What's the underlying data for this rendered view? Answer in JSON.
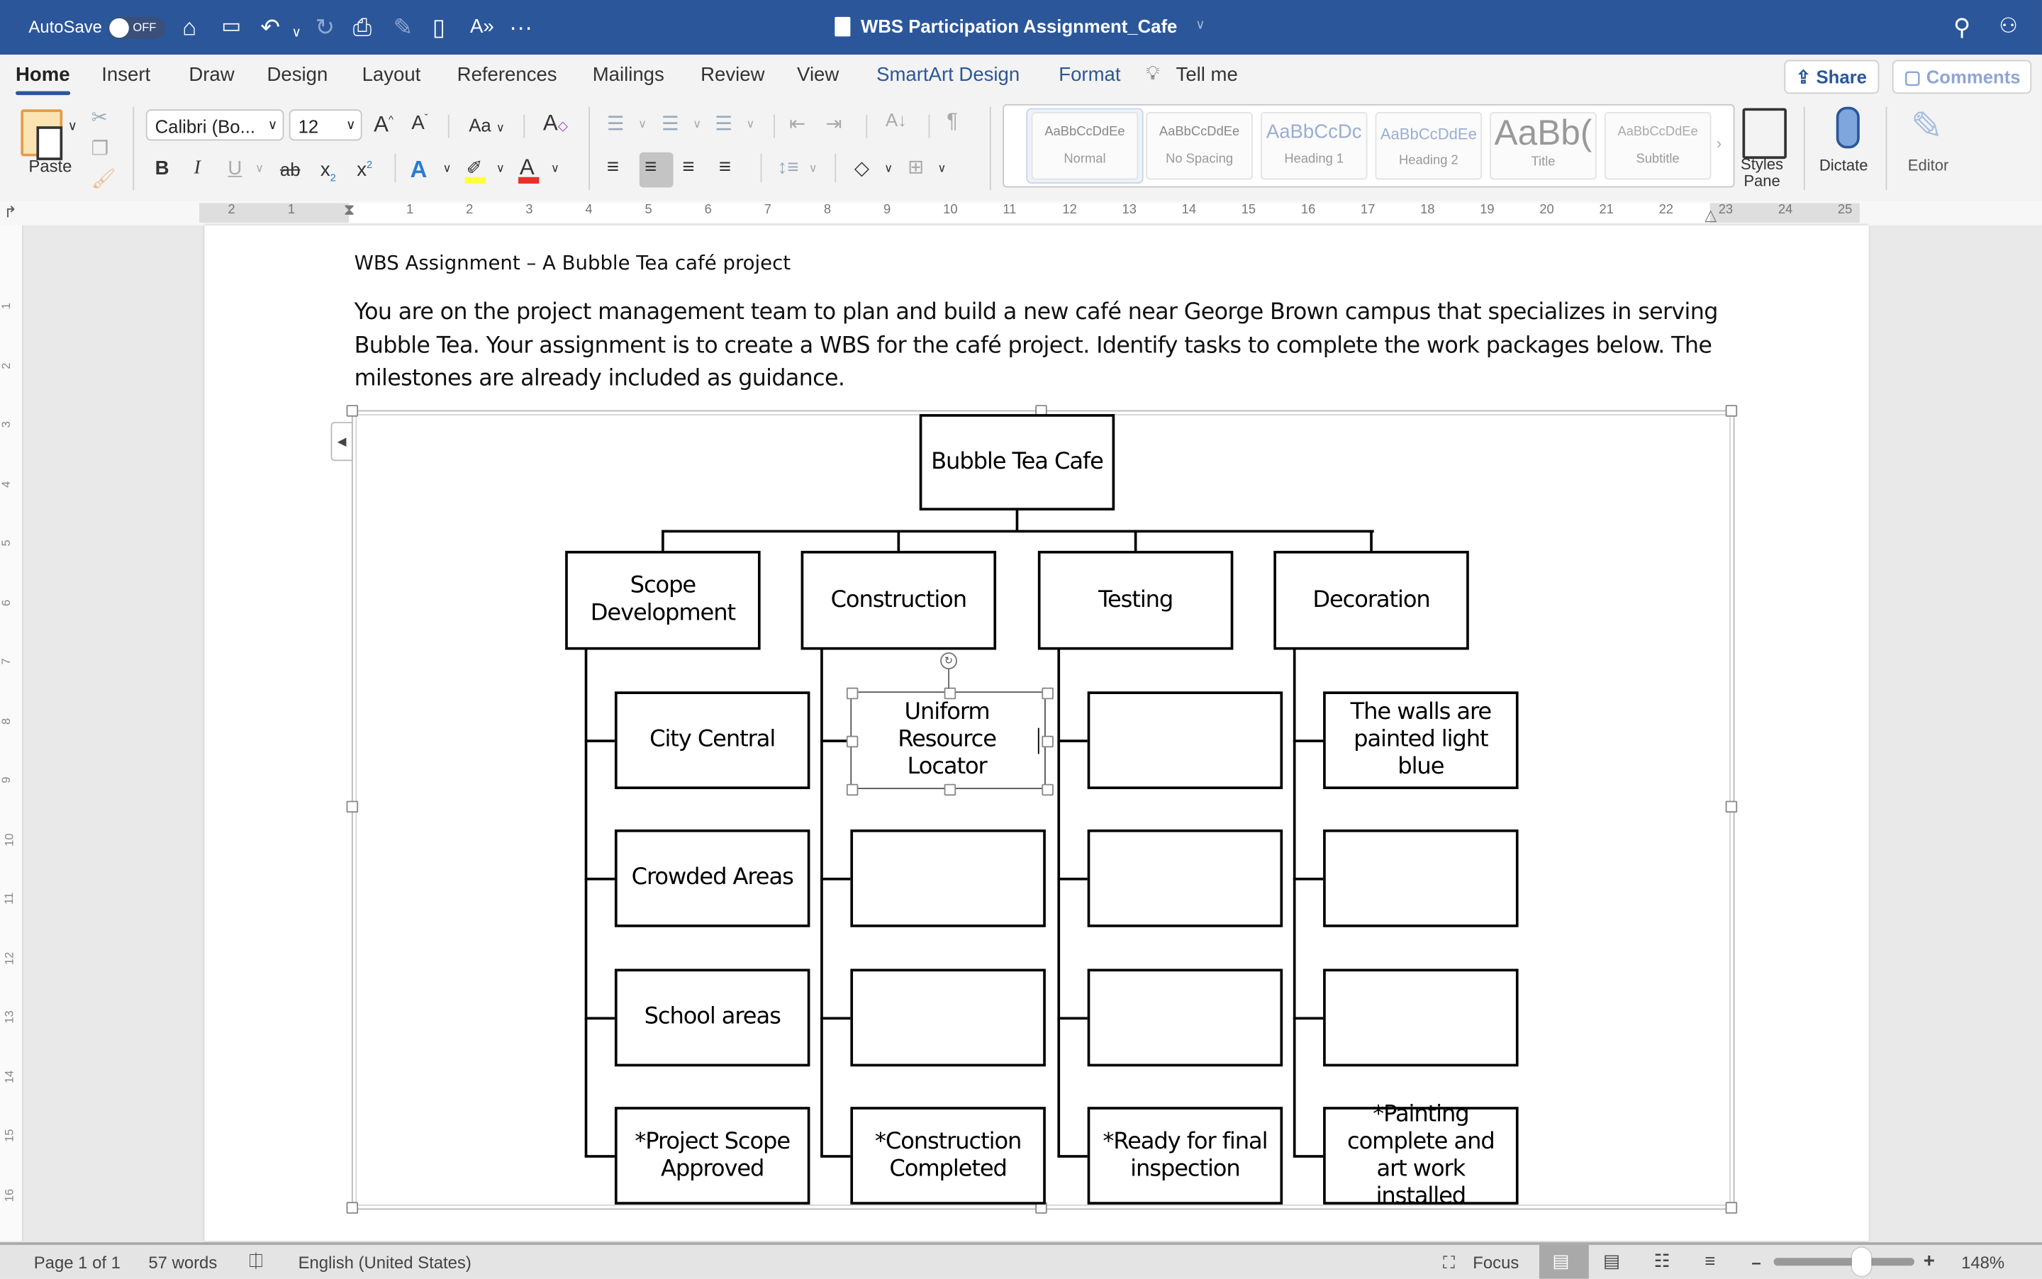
{
  "titlebar": {
    "autosave_label": "AutoSave",
    "autosave_state": "OFF",
    "document_title": "WBS Participation Assignment_Cafe",
    "quick_access": [
      "home-icon",
      "save-icon",
      "undo-icon",
      "redo-icon",
      "print-icon",
      "draw-icon",
      "new-doc-icon",
      "read-aloud-icon",
      "more-icon"
    ]
  },
  "tabs": [
    {
      "label": "Home",
      "active": true
    },
    {
      "label": "Insert"
    },
    {
      "label": "Draw"
    },
    {
      "label": "Design"
    },
    {
      "label": "Layout"
    },
    {
      "label": "References"
    },
    {
      "label": "Mailings"
    },
    {
      "label": "Review"
    },
    {
      "label": "View"
    },
    {
      "label": "SmartArt Design",
      "contextual": true
    },
    {
      "label": "Format",
      "contextual": true
    }
  ],
  "tell_me": "Tell me",
  "share_label": "Share",
  "comments_label": "Comments",
  "ribbon": {
    "paste_label": "Paste",
    "font_name": "Calibri (Bo...",
    "font_size": "12",
    "change_case": "Aa",
    "bold": "B",
    "italic": "I",
    "underline": "U",
    "strike": "ab",
    "subscript": "x",
    "superscript": "x",
    "highlight_color": "#ffff3b",
    "font_color": "#e8312a",
    "styles": [
      {
        "sample": "AaBbCcDdEe",
        "name": "Normal"
      },
      {
        "sample": "AaBbCcDdEe",
        "name": "No Spacing"
      },
      {
        "sample": "AaBbCcDc",
        "name": "Heading 1"
      },
      {
        "sample": "AaBbCcDdEe",
        "name": "Heading 2"
      },
      {
        "sample": "AaBb(",
        "name": "Title"
      },
      {
        "sample": "AaBbCcDdEe",
        "name": "Subtitle"
      }
    ],
    "styles_pane_label": "Styles Pane",
    "dictate_label": "Dictate",
    "editor_label": "Editor"
  },
  "ruler": {
    "left_numbers": [
      "2",
      "1"
    ],
    "numbers": [
      "1",
      "2",
      "3",
      "4",
      "5",
      "6",
      "7",
      "8",
      "9",
      "10",
      "11",
      "12",
      "13",
      "14",
      "15",
      "16",
      "17",
      "18",
      "19",
      "20",
      "21",
      "22",
      "23",
      "24",
      "25"
    ],
    "vertical_numbers": [
      "1",
      "2",
      "3",
      "4",
      "5",
      "6",
      "7",
      "8",
      "9",
      "10",
      "11",
      "12",
      "13",
      "14",
      "15",
      "16"
    ]
  },
  "document": {
    "heading": "WBS Assignment – A Bubble Tea café project",
    "paragraph": "You are on the project management team to plan and build a new café near George Brown campus that specializes in serving Bubble Tea. Your assignment is to create a WBS for the café project. Identify tasks to complete the work packages below. The milestones are already included as guidance."
  },
  "wbs": {
    "root": "Bubble Tea Cafe",
    "branches": [
      {
        "title": "Scope Development",
        "children": [
          "City Central",
          "Crowded Areas",
          "School areas",
          "*Project Scope Approved"
        ]
      },
      {
        "title": "Construction",
        "children": [
          "Uniform Resource Locator",
          "",
          "",
          "*Construction Completed"
        ]
      },
      {
        "title": "Testing",
        "children": [
          "",
          "",
          "",
          "*Ready for final inspection"
        ]
      },
      {
        "title": "Decoration",
        "children": [
          "The walls are painted light blue",
          "",
          "",
          "*Painting complete and art work installed"
        ]
      }
    ],
    "selected_node": "Construction.0"
  },
  "statusbar": {
    "page": "Page 1 of 1",
    "words": "57 words",
    "language": "English (United States)",
    "focus_label": "Focus",
    "zoom": "148%",
    "zoom_level_percent": 148
  },
  "colors": {
    "titlebar": "#2b579a",
    "accent": "#2b579a"
  }
}
